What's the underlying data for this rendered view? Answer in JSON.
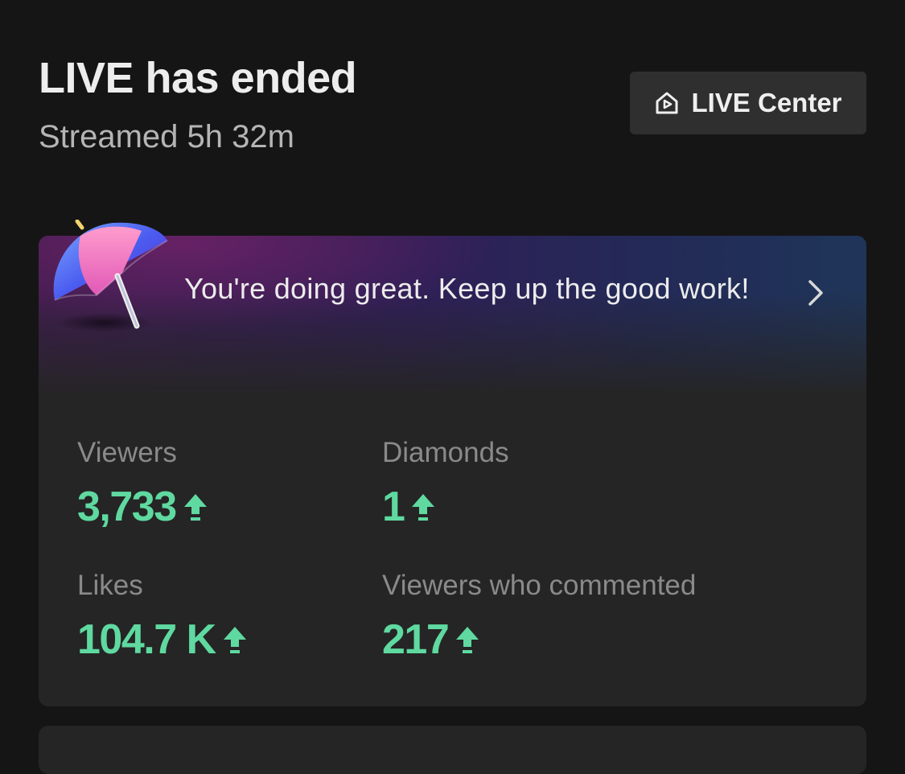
{
  "header": {
    "title": "LIVE has ended",
    "subtitle": "Streamed 5h 32m",
    "live_center_label": "LIVE Center",
    "live_center_icon": "home-play-icon"
  },
  "card": {
    "icon": "umbrella-icon",
    "message": "You're doing great. Keep up the good work!",
    "chevron_icon": "chevron-right-icon",
    "stats": [
      {
        "label": "Viewers",
        "value": "3,733",
        "trend": "up"
      },
      {
        "label": "Diamonds",
        "value": "1",
        "trend": "up"
      },
      {
        "label": "Likes",
        "value": "104.7 K",
        "trend": "up"
      },
      {
        "label": "Viewers who commented",
        "value": "217",
        "trend": "up"
      }
    ]
  },
  "colors": {
    "background": "#151515",
    "card": "#252525",
    "button": "#2f2f2f",
    "stat_value": "#5fd9a0",
    "stat_label": "#8a8a8a"
  }
}
